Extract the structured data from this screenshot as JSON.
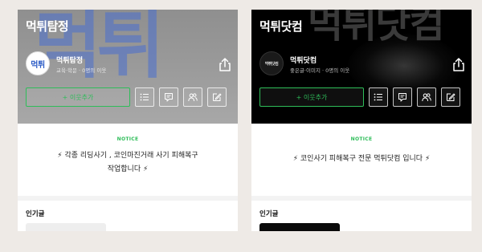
{
  "cards": [
    {
      "title": "먹튀탐정",
      "bg_text": "먹튀",
      "profile_text": "먹튀",
      "name": "먹튀탐정",
      "sub": "교육·학문 · 0명의 이웃",
      "join_label": "+  이웃추가",
      "notice_label": "NOTICE",
      "notice_line1": "⚡ 각종 리딩사기 , 코인마진거래 사기 피해복구",
      "notice_line2": "작업합니다 ⚡",
      "popular_label": "인기글"
    },
    {
      "title": "먹튀닷컴",
      "bg_text": "먹튀닷컴",
      "profile_text": "먹튀닷컴",
      "name": "먹튀닷컴",
      "sub": "좋은글·이미지 · 0명의 이웃",
      "join_label": "+  이웃추가",
      "notice_label": "NOTICE",
      "notice_line1": "⚡ 코인사기 피해복구 전문 먹튀닷컴 입니다 ⚡",
      "notice_line2": "",
      "popular_label": "인기글"
    }
  ],
  "colors": {
    "accent": "#2ebd59",
    "page_bg": "#eeeae6"
  },
  "icons": [
    "share-icon",
    "list-icon",
    "message-icon",
    "people-icon",
    "edit-icon"
  ]
}
